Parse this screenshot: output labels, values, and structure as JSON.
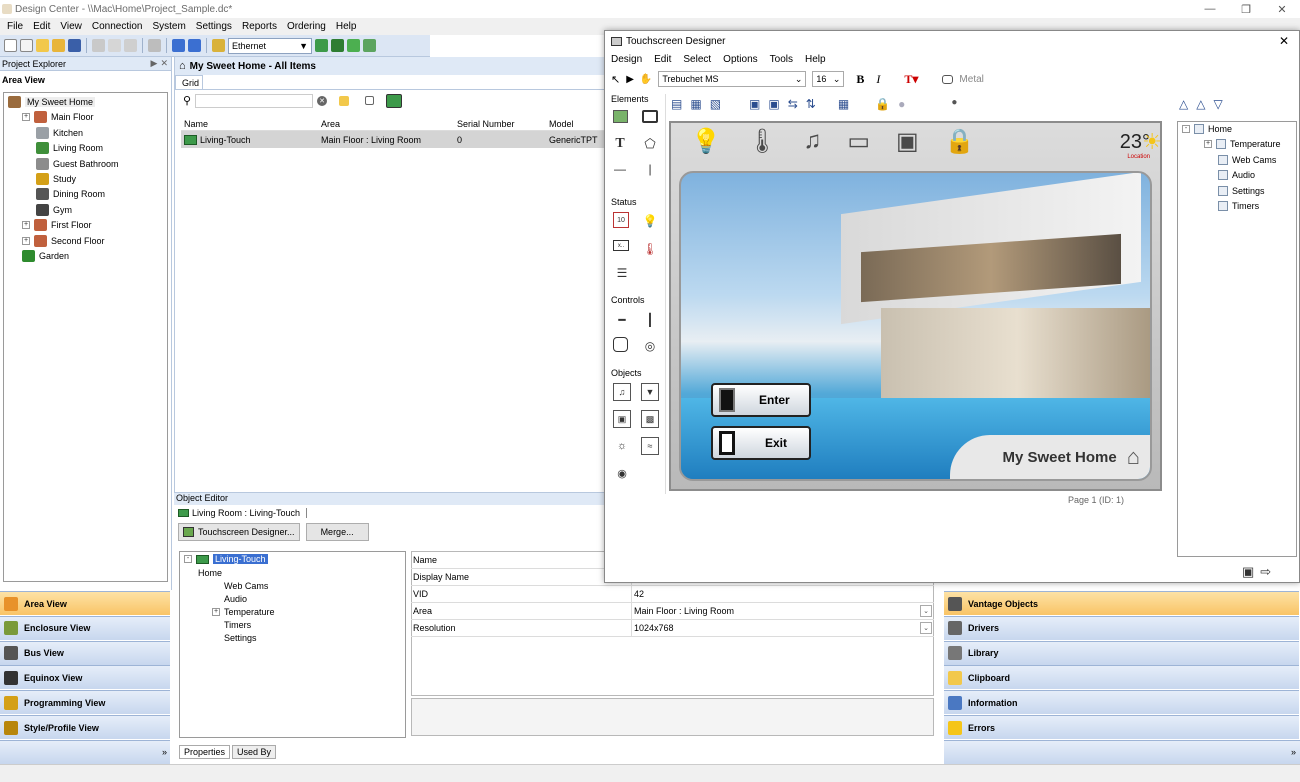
{
  "window": {
    "title": "Design Center - \\\\Mac\\Home\\Project_Sample.dc*"
  },
  "menubar": [
    "File",
    "Edit",
    "View",
    "Connection",
    "System",
    "Settings",
    "Reports",
    "Ordering",
    "Help"
  ],
  "toolbar": {
    "connection": "Ethernet"
  },
  "project_explorer": {
    "title": "Project Explorer",
    "area_view_label": "Area View",
    "tree": [
      {
        "label": "My Sweet Home",
        "level": 0,
        "icon": "home-icon"
      },
      {
        "label": "Main Floor",
        "level": 1,
        "icon": "floor-icon"
      },
      {
        "label": "Kitchen",
        "level": 2,
        "icon": "kitchen-icon"
      },
      {
        "label": "Living Room",
        "level": 2,
        "icon": "living-room-icon"
      },
      {
        "label": "Guest Bathroom",
        "level": 2,
        "icon": "bathroom-icon"
      },
      {
        "label": "Study",
        "level": 2,
        "icon": "study-icon"
      },
      {
        "label": "Dining Room",
        "level": 2,
        "icon": "dining-icon"
      },
      {
        "label": "Gym",
        "level": 2,
        "icon": "gym-icon"
      },
      {
        "label": "First Floor",
        "level": 1,
        "icon": "floor-icon"
      },
      {
        "label": "Second Floor",
        "level": 1,
        "icon": "floor-icon"
      },
      {
        "label": "Garden",
        "level": 1,
        "icon": "garden-icon"
      }
    ]
  },
  "left_nav": [
    "Area View",
    "Enclosure View",
    "Bus View",
    "Equinox View",
    "Programming View",
    "Style/Profile View"
  ],
  "center": {
    "header": "My Sweet Home - All Items",
    "tab": "Grid",
    "columns": [
      "Name",
      "Area",
      "Serial Number",
      "Model"
    ],
    "row": {
      "name": "Living-Touch",
      "area": "Main Floor : Living Room",
      "serial": "0",
      "model": "GenericTPT"
    }
  },
  "object_editor": {
    "title": "Object Editor",
    "tab": "Living Room : Living-Touch",
    "designer_button": "Touchscreen Designer...",
    "merge_button": "Merge...",
    "tree": [
      "Living-Touch",
      "Home",
      "Web Cams",
      "Audio",
      "Temperature",
      "Timers",
      "Settings"
    ],
    "props": [
      {
        "k": "Name",
        "v": ""
      },
      {
        "k": "Display Name",
        "v": ""
      },
      {
        "k": "VID",
        "v": "42"
      },
      {
        "k": "Area",
        "v": "Main Floor : Living Room"
      },
      {
        "k": "Resolution",
        "v": "1024x768"
      }
    ],
    "bottom_tabs": [
      "Properties",
      "Used By"
    ]
  },
  "right_nav": [
    "Vantage Objects",
    "Drivers",
    "Library",
    "Clipboard",
    "Information",
    "Errors"
  ],
  "designer": {
    "title": "Touchscreen Designer",
    "menu": [
      "Design",
      "Edit",
      "Select",
      "Options",
      "Tools",
      "Help"
    ],
    "font": "Trebuchet MS",
    "size": "16",
    "bold": "B",
    "italic": "I",
    "theme": "Metal",
    "sections": [
      "Elements",
      "Status",
      "Controls",
      "Objects"
    ],
    "calendar_day": "10",
    "screen": {
      "temperature": "23°",
      "location": "Location",
      "enter": "Enter",
      "exit": "Exit",
      "home_label": "My Sweet Home"
    },
    "page_label": "Page 1 (ID: 1)",
    "tree": [
      "Home",
      "Temperature",
      "Web Cams",
      "Audio",
      "Settings",
      "Timers"
    ]
  }
}
